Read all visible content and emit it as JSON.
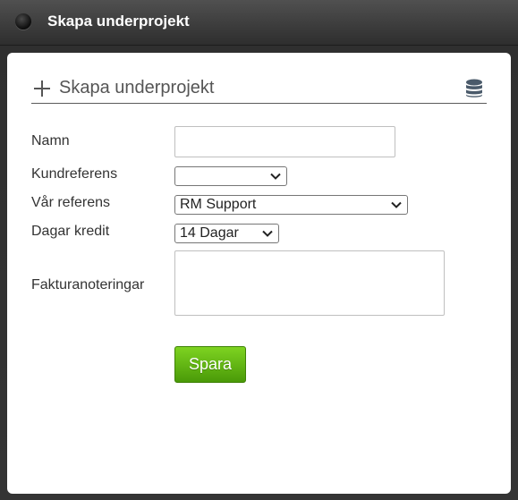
{
  "window": {
    "title": "Skapa underprojekt"
  },
  "form": {
    "heading": "Skapa underprojekt",
    "fields": {
      "name": {
        "label": "Namn",
        "value": ""
      },
      "customer_reference": {
        "label": "Kundreferens",
        "value": ""
      },
      "our_reference": {
        "label": "Vår referens",
        "value": "RM Support"
      },
      "credit_days": {
        "label": "Dagar kredit",
        "value": "14 Dagar"
      },
      "invoice_notes": {
        "label": "Fakturanoteringar",
        "value": ""
      }
    },
    "save_label": "Spara"
  },
  "colors": {
    "save_button": "#5fb511",
    "titlebar": "#3a3a3a",
    "panel": "#ffffff"
  },
  "icons": {
    "window": "window-dot-icon",
    "add": "plus-icon",
    "database": "database-icon"
  }
}
